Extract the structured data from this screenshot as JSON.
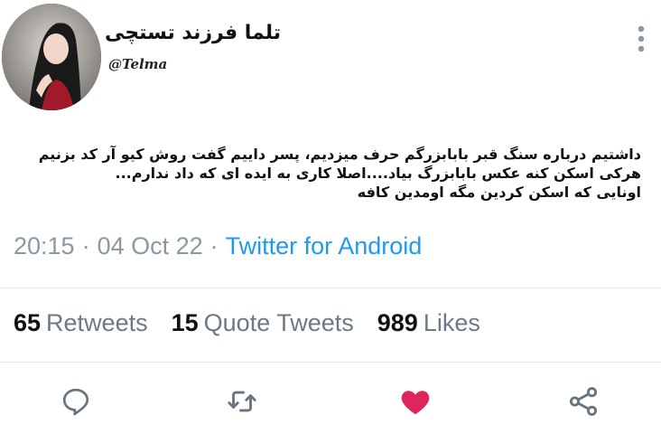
{
  "author": {
    "display_name": "تلما فرزند تستچی",
    "handle": "@Telma"
  },
  "tweet": {
    "lines": [
      "داشتیم درباره سنگ قبر بابابزرگم حرف میزدیم، پسر داییم گفت روش کیو آر کد بزنیم",
      "هرکی اسکن کنه عکس بابابزرگ بیاد....اصلا کاری به ایده ای که داد ندارم...",
      "اونایی که اسکن کردین مگه اومدین کافه"
    ]
  },
  "meta": {
    "time": "20:15",
    "separator": "·",
    "date": "04 Oct 22",
    "source": "Twitter for Android"
  },
  "stats": {
    "retweets": {
      "count": "65",
      "label": "Retweets"
    },
    "quotes": {
      "count": "15",
      "label": "Quote Tweets"
    },
    "likes": {
      "count": "989",
      "label": "Likes"
    }
  },
  "colors": {
    "like_active": "#e0245e",
    "icon_gray": "#66757f",
    "link_blue": "#1d9bf0"
  },
  "icons": {
    "reply": "reply-icon",
    "retweet": "retweet-icon",
    "like": "heart-icon",
    "share": "share-icon",
    "more": "more-vertical-icon"
  }
}
